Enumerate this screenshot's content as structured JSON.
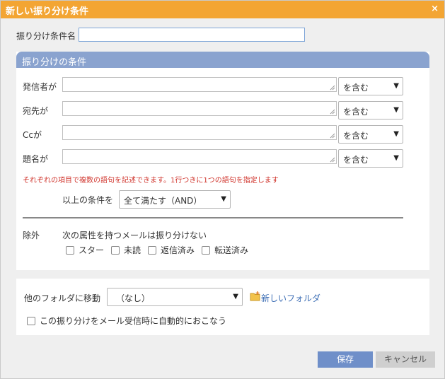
{
  "dialog": {
    "title": "新しい振り分け条件",
    "close_symbol": "×"
  },
  "name_field": {
    "label": "振り分け条件名",
    "value": ""
  },
  "conditions": {
    "header": "振り分けの条件",
    "rows": [
      {
        "label": "発信者が",
        "value": "",
        "match": "を含む"
      },
      {
        "label": "宛先が",
        "value": "",
        "match": "を含む"
      },
      {
        "label": "Ccが",
        "value": "",
        "match": "を含む"
      },
      {
        "label": "題名が",
        "value": "",
        "match": "を含む"
      }
    ],
    "note": "それぞれの項目で複数の語句を記述できます。1行つきに1つの語句を指定します",
    "logic_label": "以上の条件を",
    "logic_value": "全て満たす（AND）"
  },
  "exclusion": {
    "label": "除外",
    "description": "次の属性を持つメールは振り分けない",
    "options": [
      "スター",
      "未読",
      "返信済み",
      "転送済み"
    ]
  },
  "folder": {
    "label": "他のフォルダに移動",
    "value": "（なし）",
    "new_folder_link": "新しいフォルダ",
    "auto_apply_label": "この振り分けをメール受信時に自動的におこなう"
  },
  "buttons": {
    "save": "保存",
    "cancel": "キャンセル"
  },
  "colors": {
    "title_bar": "#f3a533",
    "panel_header": "#8aa3cf",
    "save_button": "#6f8fc9",
    "note_text": "#d0342c"
  }
}
